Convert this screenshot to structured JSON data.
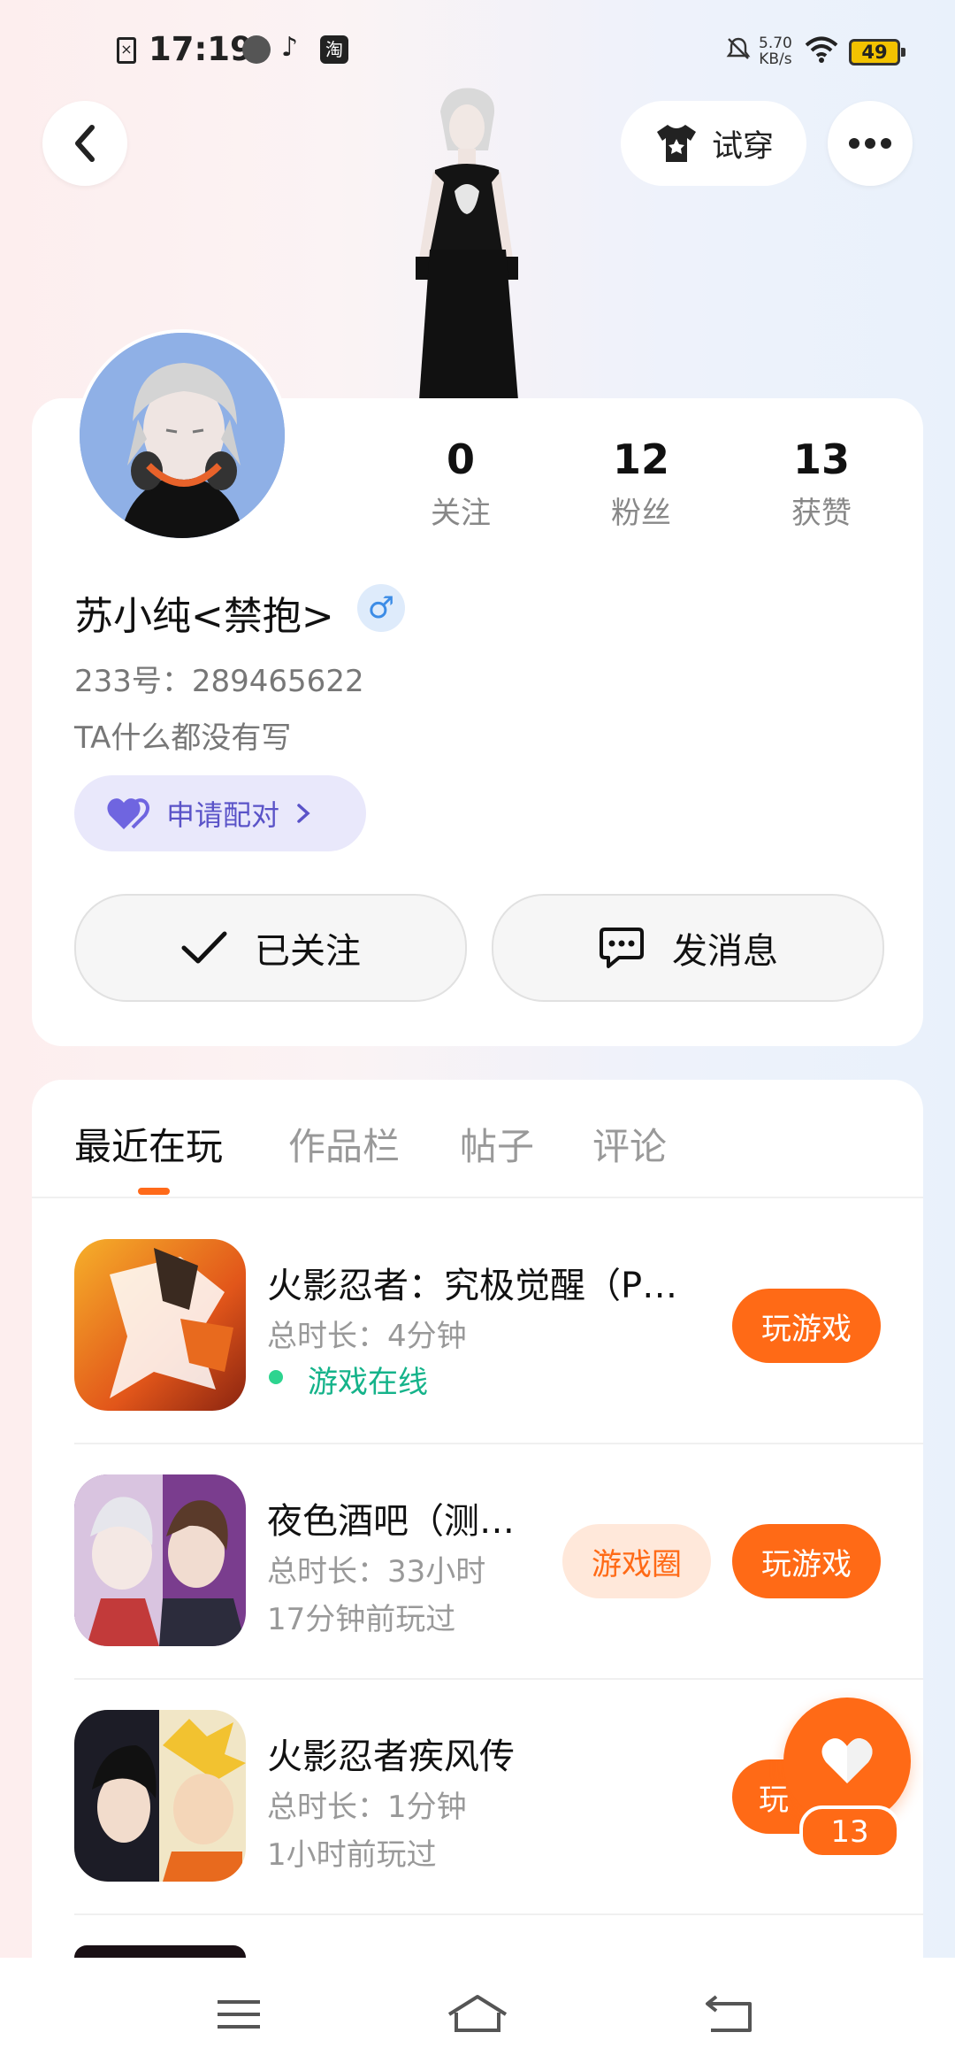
{
  "status_bar": {
    "time": "17:19",
    "icon_3": "淘",
    "net_speed_value": "5.70",
    "net_speed_unit": "KB/s",
    "battery": "49"
  },
  "header": {
    "tryon_label": "试穿"
  },
  "profile": {
    "stats": [
      {
        "value": "0",
        "label": "关注"
      },
      {
        "value": "12",
        "label": "粉丝"
      },
      {
        "value": "13",
        "label": "获赞"
      }
    ],
    "name": "苏小纯<禁抱>",
    "gender_symbol": "♂",
    "id_line": "233号：289465622",
    "bio": "TA什么都没有写",
    "pair_label": "申请配对",
    "follow_label": "已关注",
    "message_label": "发消息"
  },
  "tabs": [
    "最近在玩",
    "作品栏",
    "帖子",
    "评论"
  ],
  "games": [
    {
      "title": "火影忍者：究极觉醒（P…",
      "duration": "总时长：4分钟",
      "status": "游戏在线",
      "play_label": "玩游戏"
    },
    {
      "title": "夜色酒吧（测…",
      "duration": "总时长：33小时",
      "status": "17分钟前玩过",
      "circle_label": "游戏圈",
      "play_label": "玩游戏"
    },
    {
      "title": "火影忍者疾风传",
      "duration": "总时长：1分钟",
      "status": "1小时前玩过",
      "play_label": "玩"
    }
  ],
  "fab": {
    "count": "13"
  },
  "colors": {
    "accent": "#ff6a16",
    "online": "#15b38a",
    "pair": "#5a53c8"
  }
}
